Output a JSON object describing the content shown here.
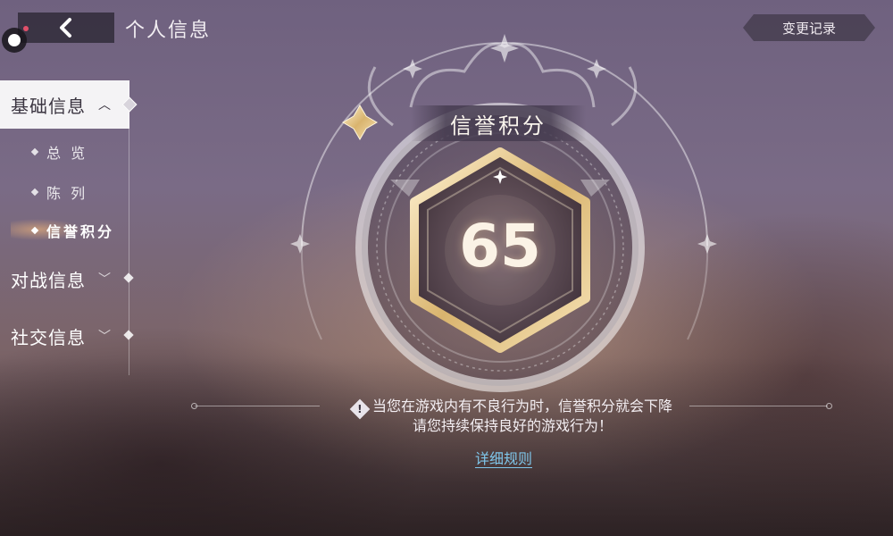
{
  "header": {
    "title": "个人信息",
    "back_icon": "chevron-left-icon",
    "history_label": "变更记录"
  },
  "sidebar": {
    "categories": [
      {
        "label": "基础信息",
        "expanded": true
      },
      {
        "label": "对战信息",
        "expanded": false
      },
      {
        "label": "社交信息",
        "expanded": false
      }
    ],
    "sub_items": [
      {
        "label": "总 览"
      },
      {
        "label": "陈 列"
      },
      {
        "label": "信誉积分",
        "selected": true
      }
    ]
  },
  "credit": {
    "title": "信誉积分",
    "score": "65"
  },
  "notice": {
    "line1": "当您在游戏内有不良行为时，信誉积分就会下降",
    "line2": "请您持续保持良好的游戏行为！",
    "link": "详细规则"
  },
  "colors": {
    "gold": "#e7c98f",
    "link": "#7fc6ea",
    "sidebar_active_bg": "#f0eef2"
  }
}
